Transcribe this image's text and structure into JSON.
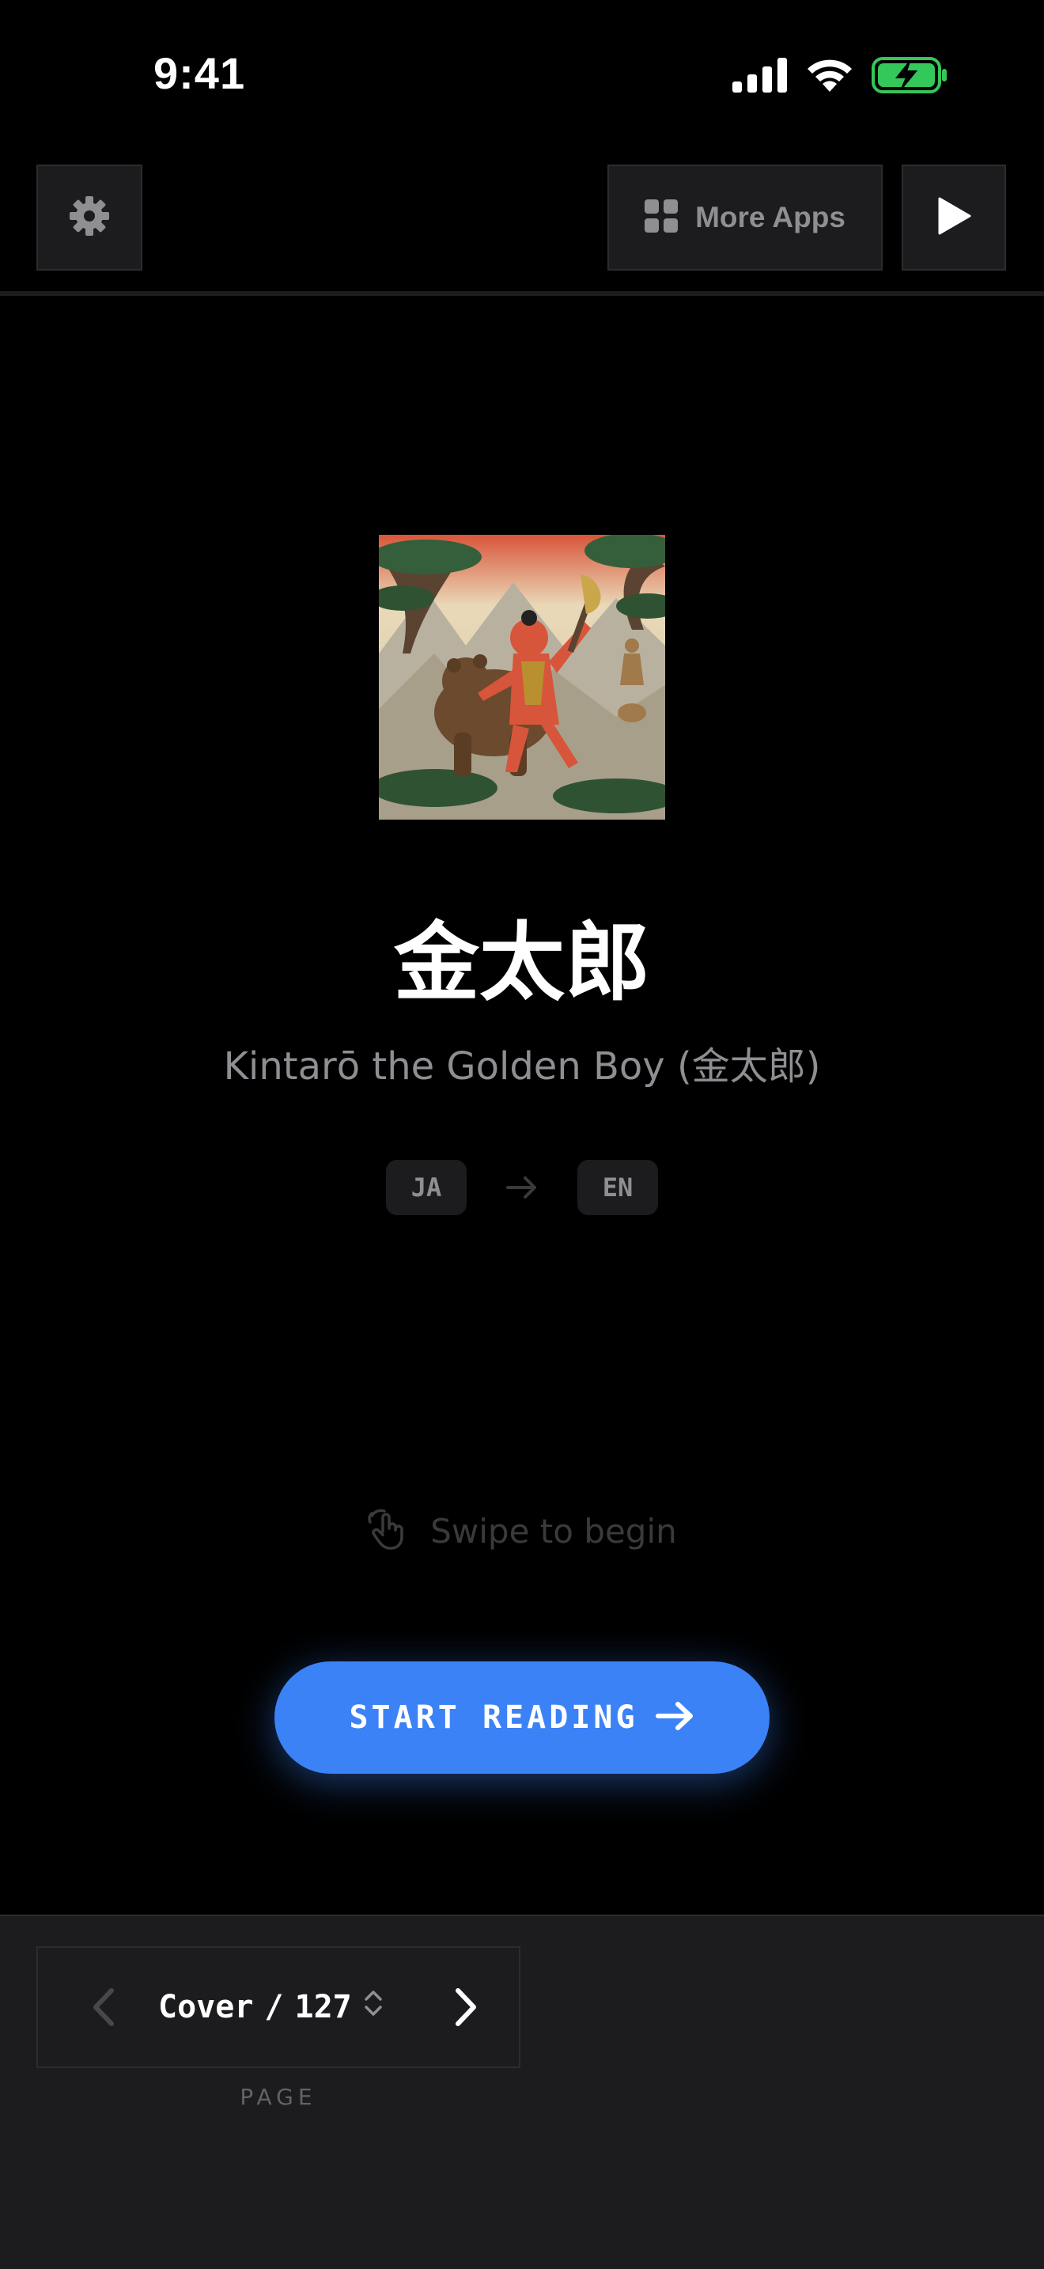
{
  "status_bar": {
    "time": "9:41"
  },
  "top_bar": {
    "settings_icon": "gear-icon",
    "more_apps_label": "More Apps",
    "more_apps_icon": "grid-icon",
    "play_icon": "play-icon"
  },
  "book": {
    "title": "金太郎",
    "subtitle": "Kintarō the Golden Boy (金太郎)",
    "source_lang": "JA",
    "target_lang": "EN"
  },
  "swipe_hint": {
    "label": "Swipe to begin",
    "icon": "hand-swipe-icon"
  },
  "start_button": {
    "label": "START READING",
    "icon": "arrow-right-icon"
  },
  "pager": {
    "current": "Cover",
    "separator": "/",
    "total": "127",
    "caption": "PAGE"
  },
  "colors": {
    "accent": "#3b82f6",
    "background": "#000000",
    "panel": "#1c1c1e",
    "muted_text": "#8e8e93",
    "battery": "#34c759"
  }
}
